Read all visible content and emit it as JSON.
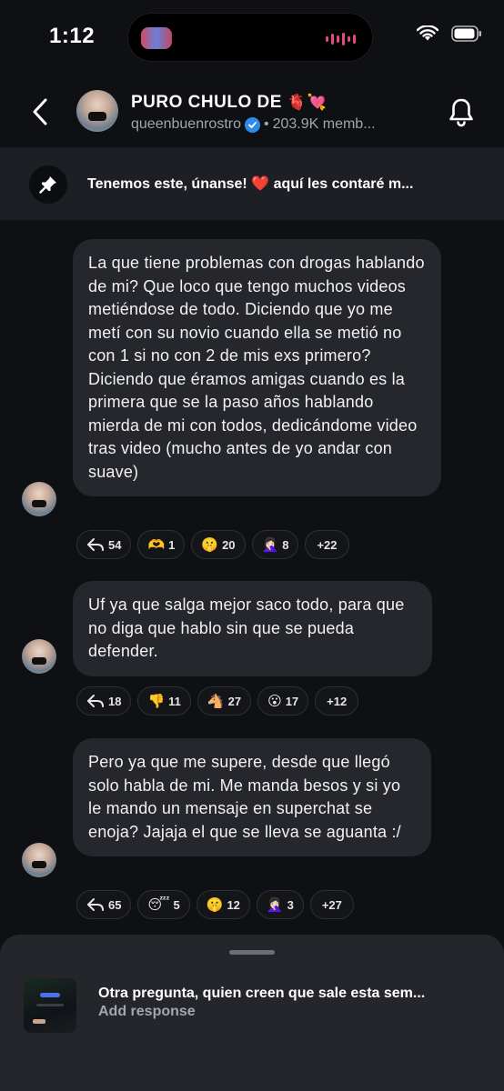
{
  "status_bar": {
    "time": "1:12"
  },
  "header": {
    "title": "PURO CHULO DE",
    "title_emoji": "🫀💘",
    "username": "queenbuenrostro",
    "members": "203.9K memb..."
  },
  "pinned": {
    "text": "Tenemos este, únanse! ❤️ aquí les contaré m..."
  },
  "messages": [
    {
      "text": "La que tiene problemas con drogas hablando de mi? Que loco que tengo muchos videos metiéndose de todo. Diciendo que yo me metí con su novio cuando ella se metió no con 1 si no con 2 de mis exs primero? Diciendo que éramos amigas cuando es la primera que se la paso años hablando mierda de mi con todos, dedicándome video tras video (mucho antes de yo andar con suave)",
      "reactions": [
        {
          "emoji": "↩",
          "count": "54"
        },
        {
          "emoji": "🫶",
          "count": "1"
        },
        {
          "emoji": "🤫",
          "count": "20"
        },
        {
          "emoji": "🤦🏻‍♀️",
          "count": "8"
        }
      ],
      "more": "+22"
    },
    {
      "text": "Uf ya que salga mejor saco todo, para que no diga que hablo sin que se pueda defender.",
      "reactions": [
        {
          "emoji": "↩",
          "count": "18"
        },
        {
          "emoji": "👎",
          "count": "11"
        },
        {
          "emoji": "🐴",
          "count": "27"
        },
        {
          "emoji": "😮",
          "count": "17"
        }
      ],
      "more": "+12"
    },
    {
      "text": "Pero ya que me supere, desde que llegó solo habla de mi. Me manda besos y si yo le mando un mensaje en superchat se enoja? Jajaja el que se lleva se aguanta :/",
      "reactions": [
        {
          "emoji": "↩",
          "count": "65"
        },
        {
          "emoji": "😴",
          "count": "5"
        },
        {
          "emoji": "🤫",
          "count": "12"
        },
        {
          "emoji": "🤦🏻‍♀️",
          "count": "3"
        }
      ],
      "more": "+27"
    }
  ],
  "sheet": {
    "title": "Otra pregunta, quien creen que sale esta sem...",
    "subtitle": "Add response"
  },
  "colors": {
    "background": "#0f1014",
    "bubble": "#25272c",
    "pinned_bg": "#1e1f24",
    "verified": "#2f8bea",
    "muted_text": "#a3a6ae"
  }
}
